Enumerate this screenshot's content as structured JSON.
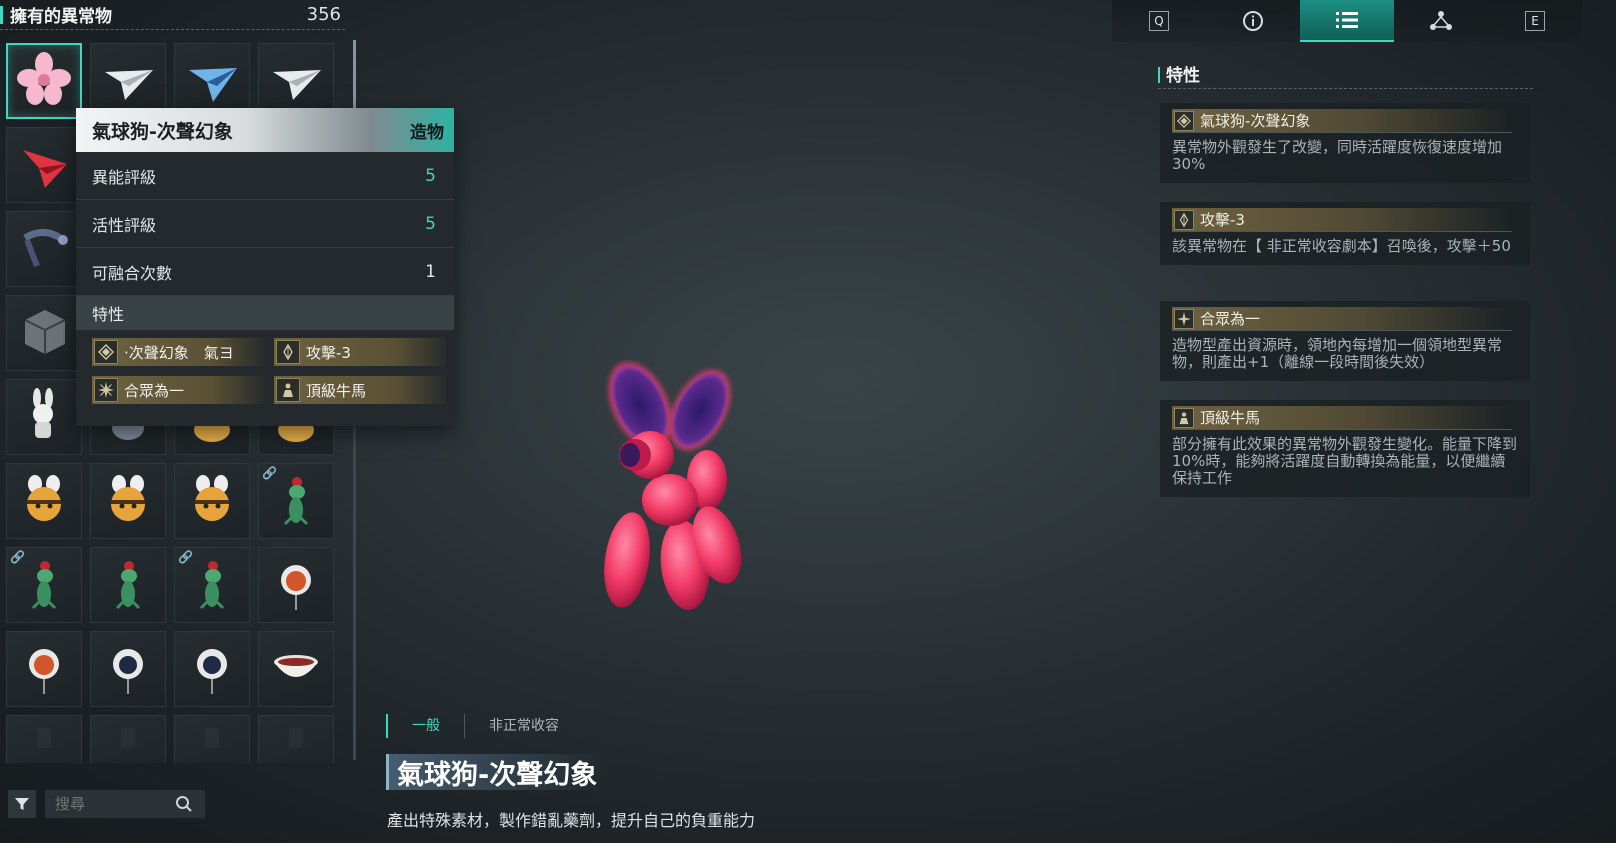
{
  "inventory": {
    "title": "擁有的異常物",
    "count": "356",
    "search_placeholder": "搜尋",
    "items": [
      {
        "icon": "pink-flower"
      },
      {
        "icon": "paper-plane-white"
      },
      {
        "icon": "paper-plane-blue"
      },
      {
        "icon": "paper-plane-white"
      },
      {
        "icon": "paper-plane-red"
      },
      {
        "icon": "hidden"
      },
      {
        "icon": "hidden"
      },
      {
        "icon": "hidden"
      },
      {
        "icon": "mechanical-arm"
      },
      {
        "icon": "hidden"
      },
      {
        "icon": "hidden"
      },
      {
        "icon": "hidden"
      },
      {
        "icon": "metal-cube"
      },
      {
        "icon": "hidden"
      },
      {
        "icon": "hidden"
      },
      {
        "icon": "hidden"
      },
      {
        "icon": "white-rabbit"
      },
      {
        "icon": "gray-creature"
      },
      {
        "icon": "yellow-bee-partial"
      },
      {
        "icon": "yellow-bee-partial"
      },
      {
        "icon": "yellow-bee"
      },
      {
        "icon": "yellow-bee"
      },
      {
        "icon": "yellow-bee"
      },
      {
        "icon": "green-lizard",
        "linked": true
      },
      {
        "icon": "green-lizard",
        "linked": true
      },
      {
        "icon": "green-lizard"
      },
      {
        "icon": "green-lizard",
        "linked": true
      },
      {
        "icon": "round-robot-red"
      },
      {
        "icon": "round-robot-red"
      },
      {
        "icon": "round-robot-white"
      },
      {
        "icon": "round-robot-white"
      },
      {
        "icon": "bowl"
      },
      {
        "icon": "faded"
      },
      {
        "icon": "faded"
      },
      {
        "icon": "faded"
      },
      {
        "icon": "faded"
      }
    ]
  },
  "tooltip": {
    "name": "氣球狗-次聲幻象",
    "type": "造物",
    "rows": [
      {
        "label": "異能評級",
        "value": "5"
      },
      {
        "label": "活性評級",
        "value": "5"
      },
      {
        "label": "可融合次數",
        "value": "1"
      }
    ],
    "traits_label": "特性",
    "traits": [
      {
        "name": "·次聲幻象　氣ヨ",
        "icon": "diamond-icon"
      },
      {
        "name": "攻擊-3",
        "icon": "crystal-icon"
      },
      {
        "name": "合眾為一",
        "icon": "star-burst-icon"
      },
      {
        "name": "頂級牛馬",
        "icon": "worker-icon"
      }
    ]
  },
  "center": {
    "tabs": [
      "一般",
      "非正常收容"
    ],
    "title": "氣球狗-次聲幻象",
    "description": "產出特殊素材，製作錯亂藥劑，提升自己的負重能力"
  },
  "top_tabs": [
    {
      "key": "Q"
    },
    {
      "icon": "info-icon"
    },
    {
      "icon": "list-icon",
      "active": true
    },
    {
      "icon": "nodes-icon"
    },
    {
      "key": "E"
    }
  ],
  "right": {
    "title": "特性",
    "traits": [
      {
        "name": "氣球狗-次聲幻象",
        "icon": "diamond-icon",
        "description": "異常物外觀發生了改變，同時活躍度恢復速度增加30%"
      },
      {
        "name": "攻擊-3",
        "icon": "crystal-icon",
        "description": "該異常物在【 非正常收容劇本】召喚後，攻擊＋50"
      },
      {
        "name": "合眾為一",
        "icon": "star-burst-icon",
        "description": "造物型產出資源時，領地內每增加一個領地型異常物，則產出+1（離線一段時間後失效）"
      },
      {
        "name": "頂級牛馬",
        "icon": "worker-icon",
        "description": "部分擁有此效果的異常物外觀發生變化。能量下降到10%時，能夠將活躍度自動轉換為能量，以便繼續保持工作"
      }
    ]
  },
  "colors": {
    "accent": "#3fd9c2",
    "trait_gold": "#6e6240",
    "balloon": "#ff4f7a"
  }
}
